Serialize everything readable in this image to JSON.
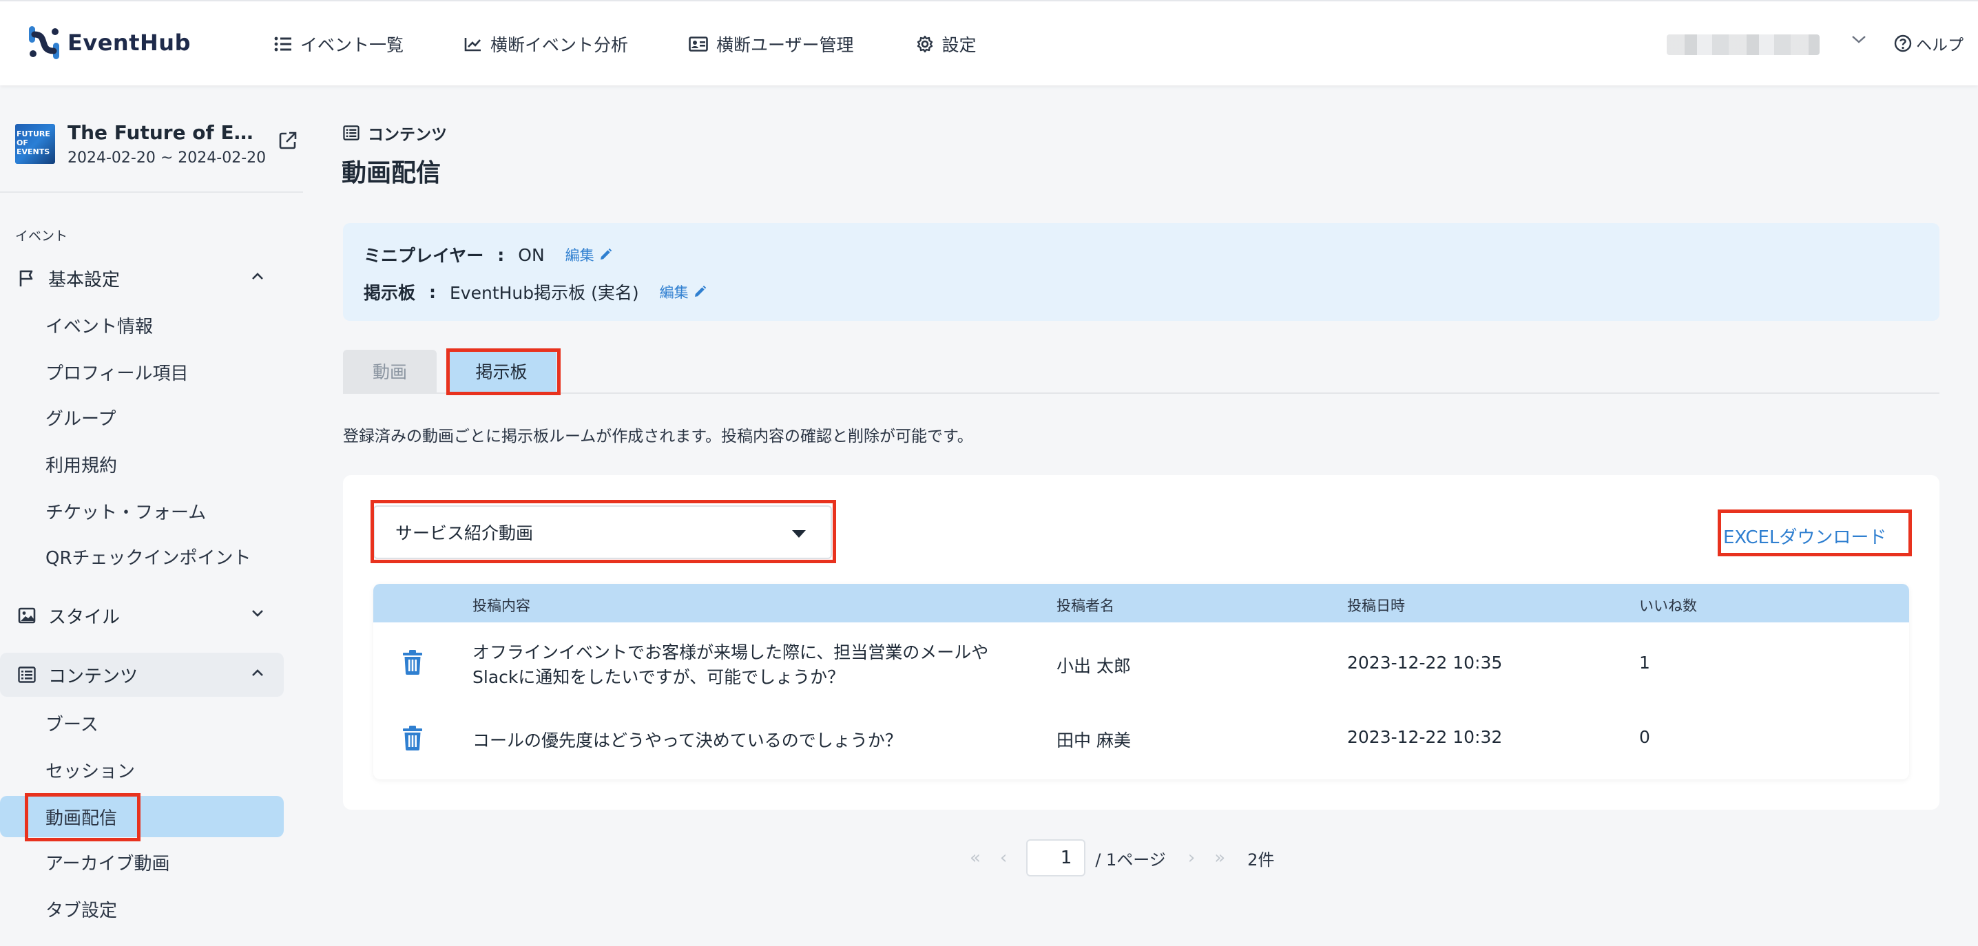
{
  "header": {
    "brand": "EventHub",
    "nav": [
      {
        "label": "イベント一覧",
        "icon": "list-icon"
      },
      {
        "label": "横断イベント分析",
        "icon": "chart-icon"
      },
      {
        "label": "横断ユーザー管理",
        "icon": "id-card-icon"
      },
      {
        "label": "設定",
        "icon": "gear-icon"
      }
    ],
    "help": "ヘルプ"
  },
  "sidebar": {
    "event": {
      "thumb_text": "FUTURE OF EVENTS",
      "title": "The Future of Events",
      "date": "2024-02-20 ~ 2024-02-20"
    },
    "section_label": "イベント",
    "groups": {
      "basic": {
        "label": "基本設定",
        "icon": "flag-icon"
      },
      "style": {
        "label": "スタイル",
        "icon": "image-icon"
      },
      "content": {
        "label": "コンテンツ",
        "icon": "list-icon"
      }
    },
    "basic_items": [
      "イベント情報",
      "プロフィール項目",
      "グループ",
      "利用規約",
      "チケット・フォーム",
      "QRチェックインポイント"
    ],
    "content_items": [
      "ブース",
      "セッション",
      "動画配信",
      "アーカイブ動画",
      "タブ設定"
    ],
    "selected_item": "動画配信"
  },
  "main": {
    "breadcrumb": "コンテンツ",
    "title": "動画配信",
    "settings": {
      "mini_player": {
        "key": "ミニプレイヤー",
        "sep": ":",
        "value": "ON",
        "edit": "編集"
      },
      "board": {
        "key": "掲示板",
        "sep": ":",
        "value": "EventHub掲示板 (実名)",
        "edit": "編集"
      }
    },
    "tabs": [
      "動画",
      "掲示板"
    ],
    "active_tab": "掲示板",
    "description": "登録済みの動画ごとに掲示板ルームが作成されます。投稿内容の確認と削除が可能です。",
    "video_select": "サービス紹介動画",
    "excel_download": "EXCELダウンロード",
    "table": {
      "headers": [
        "投稿内容",
        "投稿者名",
        "投稿日時",
        "いいね数"
      ],
      "rows": [
        {
          "content_line1": "オフラインイベントでお客様が来場した際に、担当営業のメールや",
          "content_line2": "Slackに通知をしたいですが、可能でしょうか？",
          "author": "小出 太郎",
          "date": "2023-12-22 10:35",
          "likes": "1"
        },
        {
          "content_line1": "コールの優先度はどうやって決めているのでしょうか？",
          "content_line2": "",
          "author": "田中 麻美",
          "date": "2023-12-22 10:32",
          "likes": "0"
        }
      ]
    },
    "pagination": {
      "page": "1",
      "of_pages": "/ 1ページ",
      "total": "2件"
    }
  },
  "colors": {
    "accent": "#2f7fd0",
    "highlight": "#e8321e",
    "selected_bg": "#b8dcf7",
    "info_bg": "#e6f2fc"
  }
}
